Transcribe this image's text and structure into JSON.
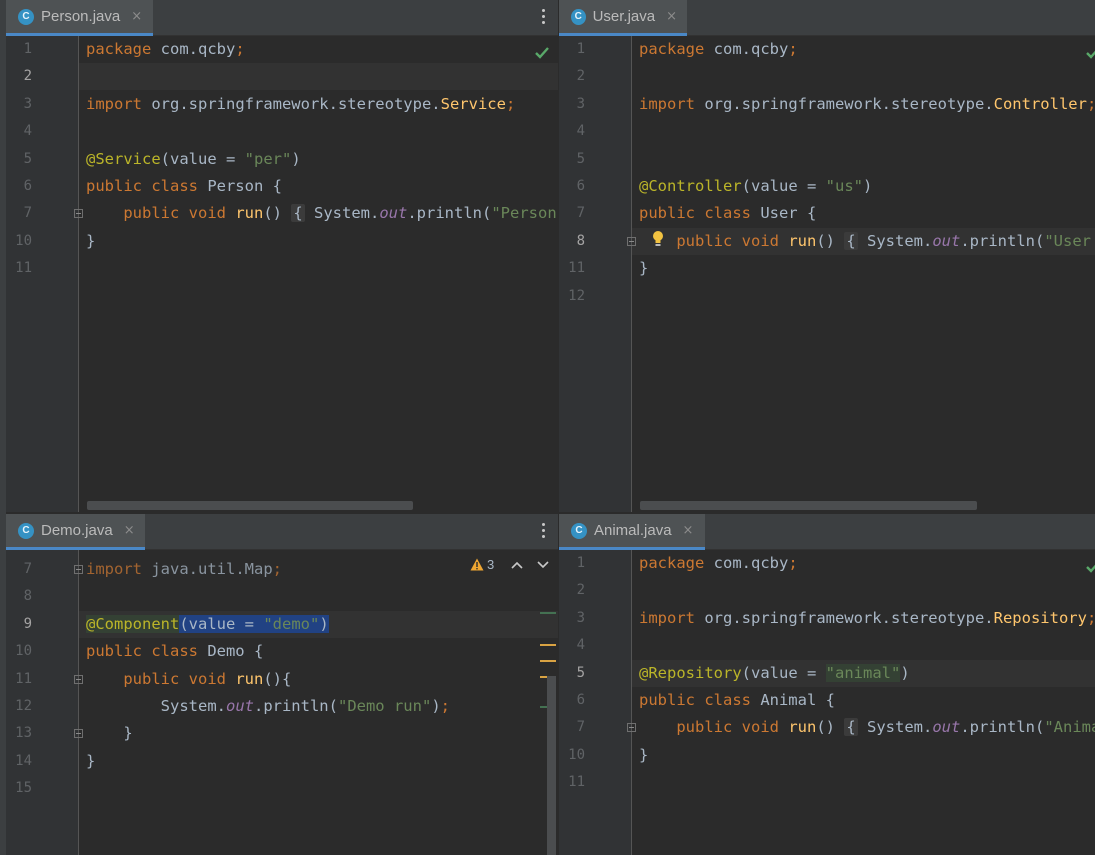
{
  "panes": {
    "person": {
      "tab": {
        "label": "Person.java",
        "icon": "class-icon",
        "icon_letter": "C",
        "close": "×"
      },
      "lines": [
        {
          "num": "1",
          "html": "<span class='kw'>package</span> com.qcby<span class='kw'>;</span>"
        },
        {
          "num": "2",
          "html": ""
        },
        {
          "num": "3",
          "html": "<span class='kw'>import</span> org.springframework.stereotype.<span class='fn'>Service</span><span class='kw'>;</span>"
        },
        {
          "num": "4",
          "html": ""
        },
        {
          "num": "5",
          "html": "<span class='ann'>@Service</span>(value = <span class='str'>\"per\"</span>)"
        },
        {
          "num": "6",
          "html": "<span class='kw'>public class</span> Person {"
        },
        {
          "num": "7",
          "html": "    <span class='kw'>public void</span> <span class='fn'>run</span>() <span class='fold'>{</span> System.<span class='fld'>out</span>.println(<span class='str'>\"Person run\"</span>)<span class='kw'>;</span> <span class='fold'>}</span>"
        },
        {
          "num": "10",
          "html": "}"
        },
        {
          "num": "11",
          "html": ""
        }
      ]
    },
    "user": {
      "tab": {
        "label": "User.java",
        "icon": "class-icon",
        "icon_letter": "C",
        "close": "×"
      },
      "lines": [
        {
          "num": "1",
          "html": "<span class='kw'>package</span> com.qcby<span class='kw'>;</span>"
        },
        {
          "num": "2",
          "html": ""
        },
        {
          "num": "3",
          "html": "<span class='kw'>import</span> org.springframework.stereotype.<span class='fn'>Controller</span><span class='kw'>;</span>"
        },
        {
          "num": "4",
          "html": ""
        },
        {
          "num": "5",
          "html": ""
        },
        {
          "num": "6",
          "html": "<span class='ann'>@Controller</span>(value = <span class='str'>\"us\"</span>)"
        },
        {
          "num": "7",
          "html": "<span class='kw'>public class</span> User {"
        },
        {
          "num": "8",
          "html": "    <span class='kw'>public void</span> <span class='fn'>run</span>() <span class='fold'>{</span> System.<span class='fld'>out</span>.println(<span class='str'>\"User run\"</span>)<span class='kw'>;</span> <span class='fold'>}</span>"
        },
        {
          "num": "11",
          "html": "}"
        },
        {
          "num": "12",
          "html": ""
        }
      ]
    },
    "demo": {
      "tab": {
        "label": "Demo.java",
        "icon": "class-icon",
        "icon_letter": "C",
        "close": "×"
      },
      "warnings": {
        "count": "3",
        "icon": "warning-icon"
      },
      "lines": [
        {
          "num": "7",
          "html": "<span class='kw'>import</span> java.util.Map<span class='kw'>;</span>",
          "dim": true
        },
        {
          "num": "8",
          "html": ""
        },
        {
          "num": "9",
          "html": "<span class='ann tagbg'>@Component</span><span class='selbg'>(value = <span class='str'>\"demo\"</span>)</span>"
        },
        {
          "num": "10",
          "html": "<span class='kw'>public class</span> Demo {"
        },
        {
          "num": "11",
          "html": "    <span class='kw'>public void</span> <span class='fn'>run</span>(){"
        },
        {
          "num": "12",
          "html": "        System.<span class='fld'>out</span>.println(<span class='str'>\"Demo run\"</span>)<span class='kw'>;</span>"
        },
        {
          "num": "13",
          "html": "    }"
        },
        {
          "num": "14",
          "html": "}"
        },
        {
          "num": "15",
          "html": ""
        }
      ]
    },
    "animal": {
      "tab": {
        "label": "Animal.java",
        "icon": "class-icon",
        "icon_letter": "C",
        "close": "×"
      },
      "lines": [
        {
          "num": "1",
          "html": "<span class='kw'>package</span> com.qcby<span class='kw'>;</span>"
        },
        {
          "num": "2",
          "html": ""
        },
        {
          "num": "3",
          "html": "<span class='kw'>import</span> org.springframework.stereotype.<span class='fn'>Repository</span><span class='kw'>;</span>"
        },
        {
          "num": "4",
          "html": ""
        },
        {
          "num": "5",
          "html": "<span class='ann'>@Repository</span>(value = <span class='str tagbg'>\"animal\"</span>)"
        },
        {
          "num": "6",
          "html": "<span class='kw'>public class</span> Animal {"
        },
        {
          "num": "7",
          "html": "    <span class='kw'>public void</span> <span class='fn'>run</span>() <span class='fold'>{</span> System.<span class='fld'>out</span>.println(<span class='str'>\"Animal run\"</span>)<span class='kw'>;</span> <span class='fold'>}</span>"
        },
        {
          "num": "10",
          "html": "}"
        },
        {
          "num": "11",
          "html": ""
        }
      ]
    }
  },
  "colors": {
    "keyword": "#cc7832",
    "string": "#6a8759",
    "annotation": "#bbb529",
    "method": "#ffc66d",
    "field": "#9876aa",
    "text": "#a9b7c6",
    "selection": "#214283",
    "tab_underline": "#4a88c7"
  }
}
